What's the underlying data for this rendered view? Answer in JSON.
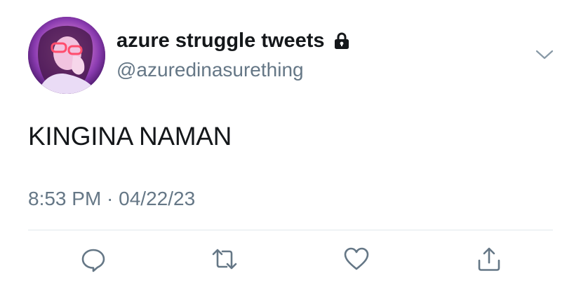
{
  "tweet": {
    "display_name": "azure struggle tweets",
    "handle": "@azuredinasurething",
    "protected": true,
    "text": "KINGINA NAMAN",
    "timestamp": "8:53 PM · 04/22/23"
  },
  "icons": {
    "lock": "lock-icon",
    "more": "chevron-down-icon",
    "reply": "reply-icon",
    "retweet": "retweet-icon",
    "like": "heart-icon",
    "share": "share-icon"
  },
  "colors": {
    "text_primary": "#14171a",
    "text_secondary": "#657786",
    "divider": "#e1e8ed",
    "icon": "#657786"
  }
}
